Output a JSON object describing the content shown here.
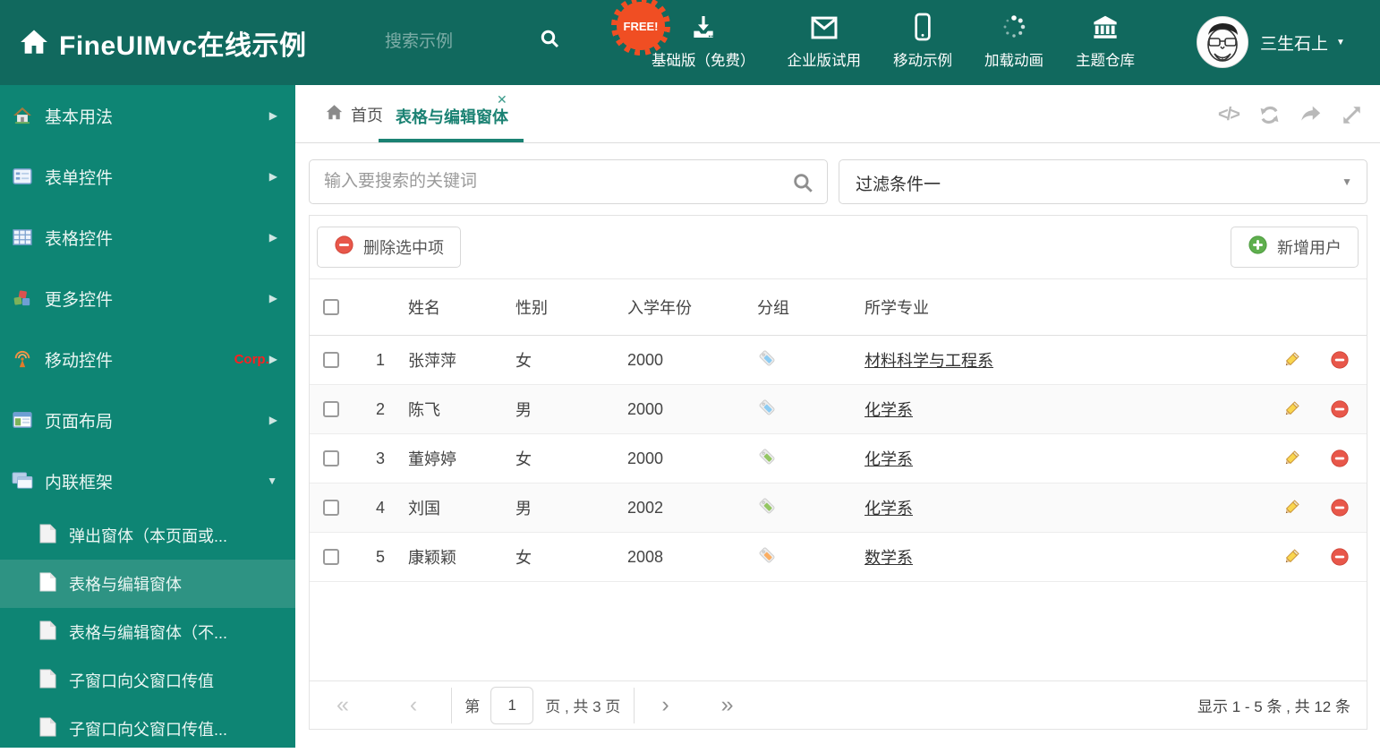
{
  "colors": {
    "header_bg": "#11695E",
    "sidebar_bg": "#0E8574",
    "sidebar_selected": "#2E9383",
    "accent": "#1B8273",
    "badge_orange": "#F04E23",
    "danger_red": "#E8574A",
    "success_green": "#5FAF4E"
  },
  "header": {
    "title": "FineUIMvc在线示例",
    "search_placeholder": "搜索示例",
    "free_badge": "FREE!",
    "nav": [
      {
        "label": "基础版（免费）",
        "icon": "download-icon"
      },
      {
        "label": "企业版试用",
        "icon": "envelope-icon"
      },
      {
        "label": "移动示例",
        "icon": "mobile-icon"
      },
      {
        "label": "加载动画",
        "icon": "spinner-icon"
      },
      {
        "label": "主题仓库",
        "icon": "bank-icon"
      }
    ],
    "username": "三生石上"
  },
  "sidebar": {
    "items": [
      {
        "label": "基本用法",
        "icon": "home-icon"
      },
      {
        "label": "表单控件",
        "icon": "form-icon"
      },
      {
        "label": "表格控件",
        "icon": "table-icon"
      },
      {
        "label": "更多控件",
        "icon": "cubes-icon"
      },
      {
        "label": "移动控件",
        "badge": "Corp.",
        "icon": "antenna-icon"
      },
      {
        "label": "页面布局",
        "icon": "layout-icon"
      },
      {
        "label": "内联框架",
        "icon": "frames-icon"
      }
    ],
    "subitems": [
      {
        "label": "弹出窗体（本页面或..."
      },
      {
        "label": "表格与编辑窗体"
      },
      {
        "label": "表格与编辑窗体（不..."
      },
      {
        "label": "子窗口向父窗口传值"
      },
      {
        "label": "子窗口向父窗口传值..."
      }
    ]
  },
  "tabs": {
    "home": "首页",
    "active": "表格与编辑窗体"
  },
  "filterbar": {
    "search_placeholder": "输入要搜索的关键词",
    "filter_selected": "过滤条件一"
  },
  "grid": {
    "delete_selected_label": "删除选中项",
    "add_user_label": "新增用户",
    "columns": {
      "name": "姓名",
      "gender": "性别",
      "year": "入学年份",
      "group": "分组",
      "major": "所学专业"
    },
    "rows": [
      {
        "num": "1",
        "name": "张萍萍",
        "gender": "女",
        "year": "2000",
        "tag_color": "#8CCBF2",
        "major": "材料科学与工程系"
      },
      {
        "num": "2",
        "name": "陈飞",
        "gender": "男",
        "year": "2000",
        "tag_color": "#8CCBF2",
        "major": "化学系"
      },
      {
        "num": "3",
        "name": "董婷婷",
        "gender": "女",
        "year": "2000",
        "tag_color": "#94C663",
        "major": "化学系"
      },
      {
        "num": "4",
        "name": "刘国",
        "gender": "男",
        "year": "2002",
        "tag_color": "#94C663",
        "major": "化学系"
      },
      {
        "num": "5",
        "name": "康颖颖",
        "gender": "女",
        "year": "2008",
        "tag_color": "#FBAE63",
        "major": "数学系"
      }
    ]
  },
  "pagination": {
    "first": "«",
    "prev": "‹",
    "next": "›",
    "last": "»",
    "page_prefix": "第",
    "page_value": "1",
    "page_suffix": "页 , 共 3 页",
    "summary": "显示 1 - 5 条 , 共 12 条"
  },
  "glyphs": {
    "code": "</>",
    "close": "✕",
    "caret_down": "▼",
    "caret_right": "▶"
  }
}
